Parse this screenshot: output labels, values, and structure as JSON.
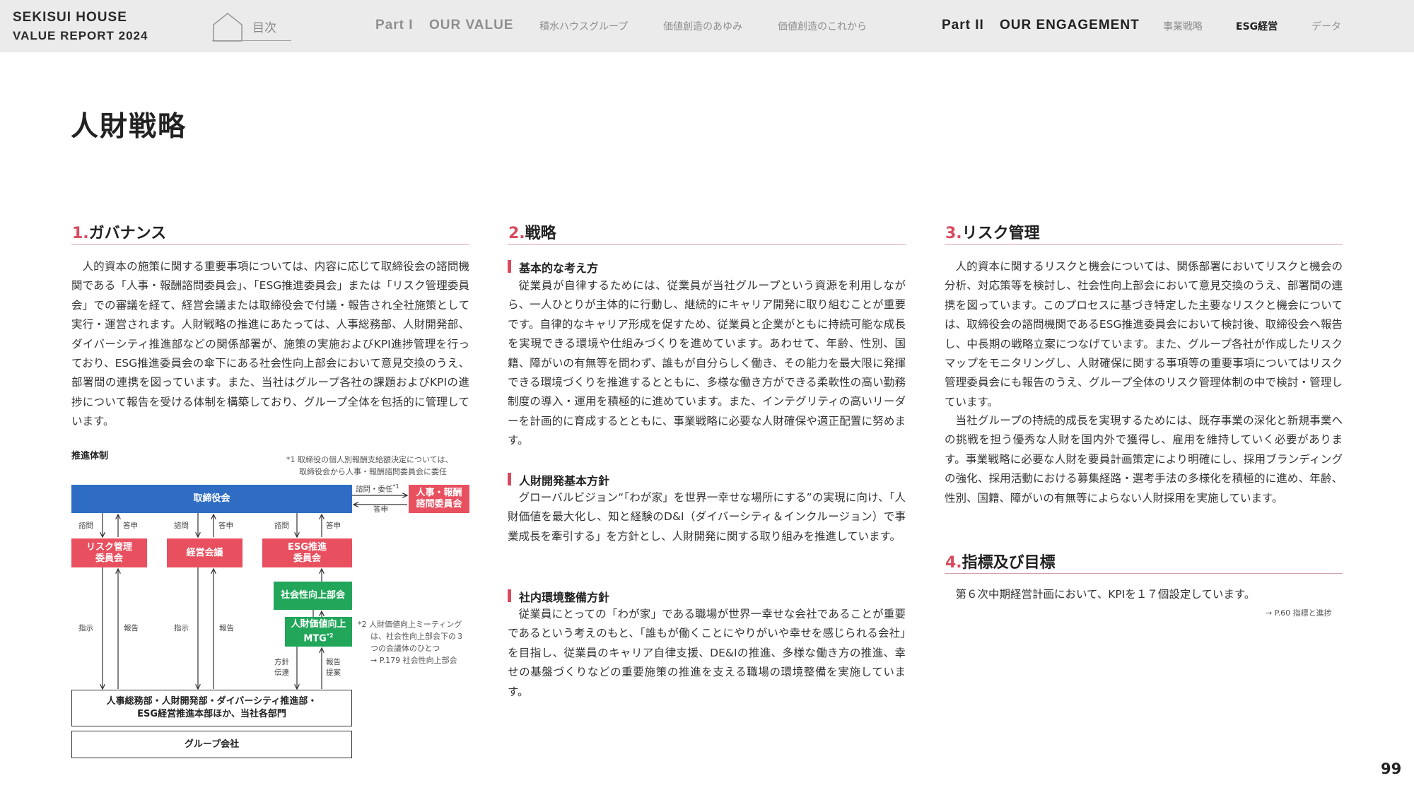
{
  "header": {
    "brand_line1": "SEKISUI HOUSE",
    "brand_line2": "VALUE REPORT 2024",
    "toc_label": "目次",
    "part1": "Part I",
    "part1_title": "OUR VALUE",
    "part1_items": [
      "積水ハウスグループ",
      "価値創造のあゆみ",
      "価値創造のこれから"
    ],
    "part2": "Part II",
    "part2_title": "OUR ENGAGEMENT",
    "part2_items": [
      "事業戦略",
      "ESG経営",
      "データ"
    ],
    "active_item": "ESG経営",
    "home_icon": "home-outline-icon"
  },
  "page_title": "人財戦略",
  "sections": {
    "governance": {
      "num": "1.",
      "title": "ガバナンス",
      "body": "人的資本の施策に関する重要事項については、内容に応じて取締役会の諮問機関である「人事・報酬諮問委員会」、「ESG推進委員会」または「リスク管理委員会」での審議を経て、経営会議または取締役会で付議・報告され全社施策として実行・運営されます。人財戦略の推進にあたっては、人事総務部、人財開発部、ダイバーシティ推進部などの関係部署が、施策の実施およびKPI進捗管理を行っており、ESG推進委員会の傘下にある社会性向上部会において意見交換のうえ、部署間の連携を図っています。また、当社はグループ各社の課題およびKPIの進捗について報告を受ける体制を構築しており、グループ全体を包括的に管理しています。"
    },
    "strategy": {
      "num": "2.",
      "title": "戦略",
      "sub1": "基本的な考え方",
      "body1": "従業員が自律するためには、従業員が当社グループという資源を利用しながら、一人ひとりが主体的に行動し、継続的にキャリア開発に取り組むことが重要です。自律的なキャリア形成を促すため、従業員と企業がともに持続可能な成長を実現できる環境や仕組みづくりを進めています。あわせて、年齢、性別、国籍、障がいの有無等を問わず、誰もが自分らしく働き、その能力を最大限に発揮できる環境づくりを推進するとともに、多様な働き方ができる柔軟性の高い勤務制度の導入・運用を積極的に進めています。また、インテグリティの高いリーダーを計画的に育成するとともに、事業戦略に必要な人財確保や適正配置に努めます。",
      "sub2": "人財開発基本方針",
      "body2": "グローバルビジョン“「わが家」を世界一幸せな場所にする”の実現に向け、「人財価値を最大化し、知と経験のD&I（ダイバーシティ＆インクルージョン）で事業成長を牽引する」を方針とし、人財開発に関する取り組みを推進しています。",
      "sub3": "社内環境整備方針",
      "body3": "従業員にとっての「わが家」である職場が世界一幸せな会社であることが重要であるという考えのもと、「誰もが働くことにやりがいや幸せを感じられる会社」を目指し、従業員のキャリア自律支援、DE&Iの推進、多様な働き方の推進、幸せの基盤づくりなどの重要施策の推進を支える職場の環境整備を実施しています。"
    },
    "risk": {
      "num": "3.",
      "title": "リスク管理",
      "body1": "人的資本に関するリスクと機会については、関係部署においてリスクと機会の分析、対応策等を検討し、社会性向上部会において意見交換のうえ、部署間の連携を図っています。このプロセスに基づき特定した主要なリスクと機会については、取締役会の諮問機関であるESG推進委員会において検討後、取締役会へ報告し、中長期の戦略立案につなげています。また、グループ各社が作成したリスクマップをモニタリングし、人財確保に関する事項等の重要事項についてはリスク管理委員会にも報告のうえ、グループ全体のリスク管理体制の中で検討・管理しています。",
      "body2": "当社グループの持続的成長を実現するためには、既存事業の深化と新規事業への挑戦を担う優秀な人財を国内外で獲得し、雇用を維持していく必要があります。事業戦略に必要な人財を要員計画策定により明確にし、採用ブランディングの強化、採用活動における募集経路・選考手法の多様化を積極的に進め、年齢、性別、国籍、障がいの有無等によらない人財採用を実施しています。"
    },
    "metrics": {
      "num": "4.",
      "title": "指標及び目標",
      "body": "第６次中期経営計画において、KPIを１７個設定しています。",
      "ref": "→ P.60 指標と進捗"
    }
  },
  "diagram": {
    "label": "推進体制",
    "note1_line1": "*1 取締役の個人別報酬支給額決定については、",
    "note1_line2": "取締役会から人事・報酬諮問委員会に委任",
    "board": "取締役会",
    "hr_committee_l1": "人事・報酬",
    "hr_committee_l2": "諮問委員会",
    "risk_committee_l1": "リスク管理",
    "risk_committee_l2": "委員会",
    "management_meeting": "経営会議",
    "esg_committee_l1": "ESG推進",
    "esg_committee_l2": "委員会",
    "social_subcommittee": "社会性向上部会",
    "mtg_l1": "人財価値向上",
    "mtg_l2": "MTG",
    "mtg_sup": "*2",
    "departments_l1": "人事総務部・人財開発部・ダイバーシティ推進部・",
    "departments_l2": "ESG経営推進本部ほか、当社各部門",
    "group_companies": "グループ会社",
    "lbl_consult_delegate": "諮問・委任",
    "lbl_consult_delegate_sup": "*1",
    "lbl_report_back": "答申",
    "lbl_consult": "諮問",
    "lbl_answer": "答申",
    "lbl_instruct": "指示",
    "lbl_report": "報告",
    "lbl_policy": "方針\n伝達",
    "lbl_proposal": "報告\n提案",
    "note2_line1": "*2 人財価値向上ミーティング",
    "note2_line2": "は、社会性向上部会下の３",
    "note2_line3": "つの会議体のひとつ",
    "note2_ref": "→ P.179 社会性向上部会"
  },
  "page_number": "99",
  "colors": {
    "accent": "#d94a5f",
    "blue": "#2e6dc3",
    "red": "#e8505f",
    "green": "#21a65a"
  }
}
